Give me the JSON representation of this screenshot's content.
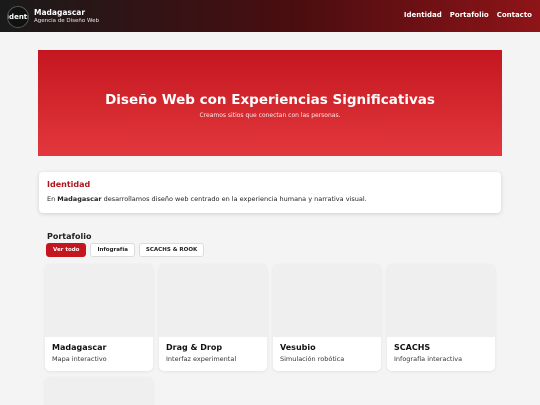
{
  "header": {
    "logo_text": "Identi",
    "brand_name": "Madagascar",
    "brand_tagline": "Agencia de Diseño Web",
    "nav": [
      "Identidad",
      "Portafolio",
      "Contacto"
    ]
  },
  "hero": {
    "title": "Diseño Web con Experiencias Significativas",
    "subtitle": "Creamos sitios que conectan con las personas."
  },
  "identity": {
    "title": "Identidad",
    "text_prefix": "En ",
    "text_bold": "Madagascar",
    "text_suffix": " desarrollamos diseño web centrado en la experiencia humana y narrativa visual."
  },
  "portfolio": {
    "title": "Portafolio",
    "filters": [
      "Ver todo",
      "Infografía",
      "SCACHS & ROOK"
    ],
    "active_filter": "Ver todo",
    "items": [
      {
        "name": "Madagascar",
        "desc": "Mapa interactivo"
      },
      {
        "name": "Drag & Drop",
        "desc": "Interfaz experimental"
      },
      {
        "name": "Vesubio",
        "desc": "Simulación robótica"
      },
      {
        "name": "SCACHS",
        "desc": "Infografía interactiva"
      }
    ]
  },
  "colors": {
    "accent": "#c4161f",
    "hero_gradient": [
      "#c4161f",
      "#e2383d"
    ],
    "topbar_gradient": [
      "#1a1a1a",
      "#8e1418"
    ],
    "background": "#f4f4f4"
  }
}
